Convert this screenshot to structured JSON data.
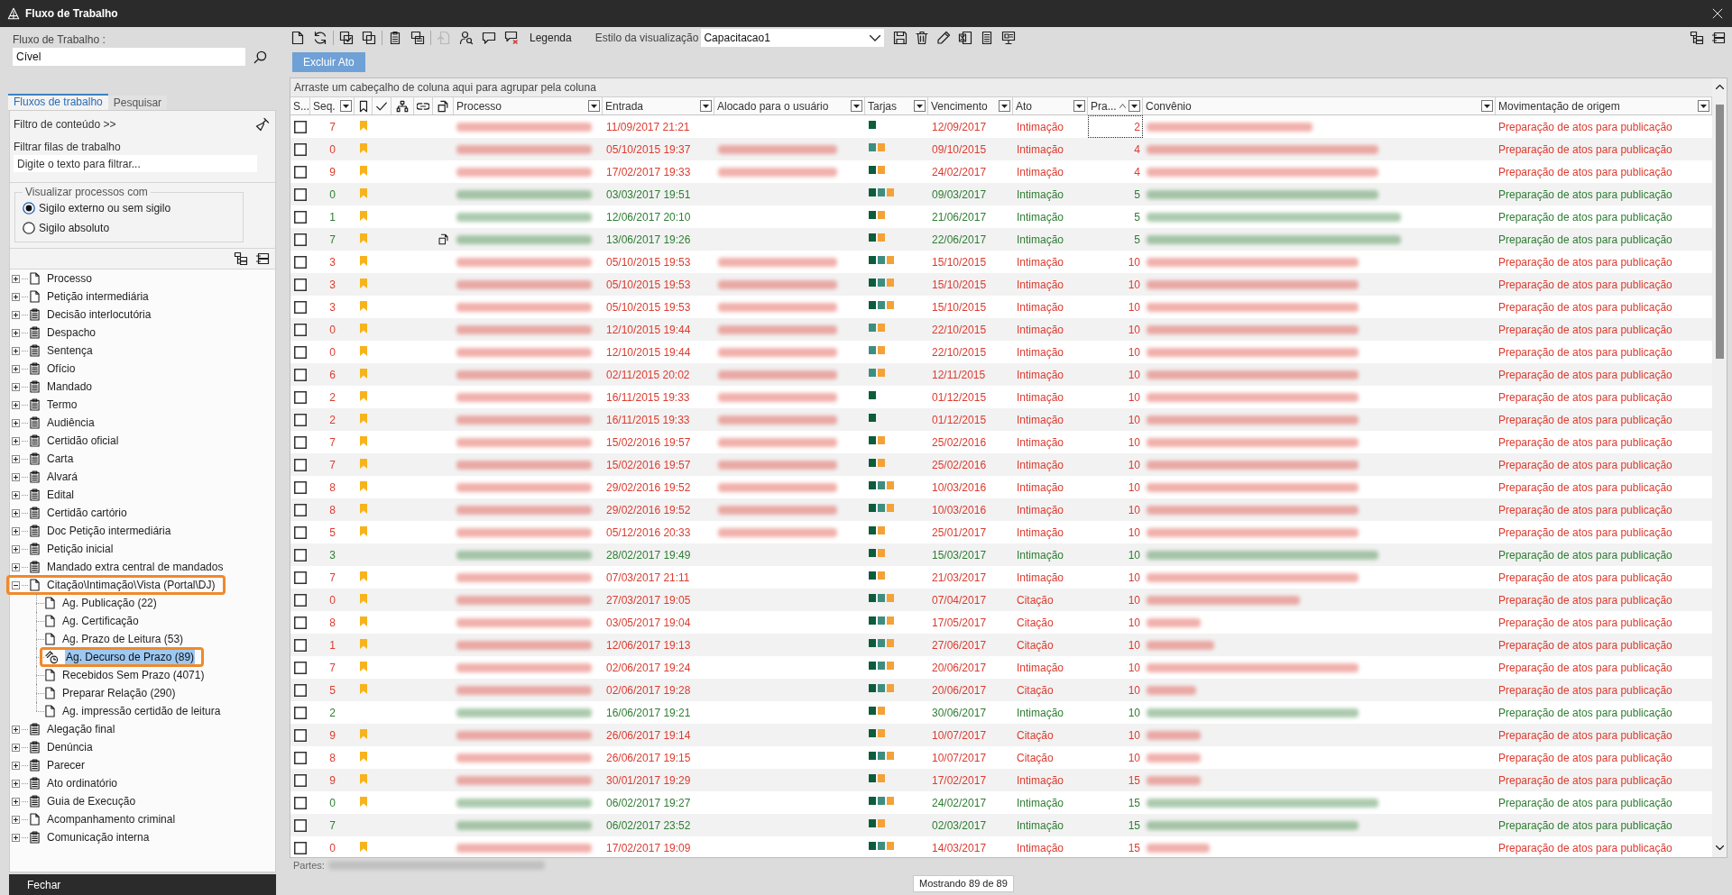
{
  "window": {
    "title": "Fluxo de Trabalho"
  },
  "left_panel": {
    "workflow": {
      "label": "Fluxo de Trabalho :",
      "value": "Cível"
    },
    "tabs": [
      {
        "label": "Fluxos de trabalho",
        "selected": true
      },
      {
        "label": "Pesquisar",
        "selected": false
      }
    ],
    "content_filter": "Filtro de conteúdo >>",
    "queue_filter": {
      "label": "Filtrar filas de trabalho",
      "placeholder": "Digite o texto para filtrar..."
    },
    "visibility": {
      "legend": "Visualizar processos com",
      "options": [
        {
          "label": "Sigilo externo ou sem sigilo",
          "selected": true
        },
        {
          "label": "Sigilo absoluto",
          "selected": false
        }
      ]
    },
    "tree": [
      {
        "label": "Processo",
        "kind": "document",
        "expanded": false,
        "selected": false,
        "highlighted": false
      },
      {
        "label": "Petição intermediária",
        "kind": "document",
        "expanded": false,
        "selected": false,
        "highlighted": false
      },
      {
        "label": "Decisão interlocutória",
        "kind": "clipboard",
        "expanded": false,
        "selected": false,
        "highlighted": false
      },
      {
        "label": "Despacho",
        "kind": "clipboard",
        "expanded": false,
        "selected": false,
        "highlighted": false
      },
      {
        "label": "Sentença",
        "kind": "clipboard",
        "expanded": false,
        "selected": false,
        "highlighted": false
      },
      {
        "label": "Ofício",
        "kind": "clipboard",
        "expanded": false,
        "selected": false,
        "highlighted": false
      },
      {
        "label": "Mandado",
        "kind": "clipboard",
        "expanded": false,
        "selected": false,
        "highlighted": false
      },
      {
        "label": "Termo",
        "kind": "clipboard",
        "expanded": false,
        "selected": false,
        "highlighted": false
      },
      {
        "label": "Audiência",
        "kind": "clipboard",
        "expanded": false,
        "selected": false,
        "highlighted": false
      },
      {
        "label": "Certidão oficial",
        "kind": "clipboard",
        "expanded": false,
        "selected": false,
        "highlighted": false
      },
      {
        "label": "Carta",
        "kind": "clipboard",
        "expanded": false,
        "selected": false,
        "highlighted": false
      },
      {
        "label": "Alvará",
        "kind": "clipboard",
        "expanded": false,
        "selected": false,
        "highlighted": false
      },
      {
        "label": "Edital",
        "kind": "clipboard",
        "expanded": false,
        "selected": false,
        "highlighted": false
      },
      {
        "label": "Certidão cartório",
        "kind": "clipboard",
        "expanded": false,
        "selected": false,
        "highlighted": false
      },
      {
        "label": "Doc Petição intermediária",
        "kind": "clipboard",
        "expanded": false,
        "selected": false,
        "highlighted": false
      },
      {
        "label": "Petição inicial",
        "kind": "clipboard",
        "expanded": false,
        "selected": false,
        "highlighted": false
      },
      {
        "label": "Mandado extra central de mandados",
        "kind": "clipboard",
        "expanded": false,
        "selected": false,
        "highlighted": false
      },
      {
        "label": "Citação\\Intimação\\Vista (Portal\\DJ)",
        "kind": "document",
        "expanded": true,
        "selected": false,
        "highlighted": true,
        "children": [
          {
            "label": "Ag. Publicação (22)",
            "kind": "document",
            "selected": false,
            "highlighted": false
          },
          {
            "label": "Ag. Certificação",
            "kind": "document",
            "selected": false,
            "highlighted": false
          },
          {
            "label": "Ag. Prazo de Leitura (53)",
            "kind": "document",
            "selected": false,
            "highlighted": false
          },
          {
            "label": "Ag. Decurso de Prazo (89)",
            "kind": "clock",
            "selected": true,
            "highlighted": true
          },
          {
            "label": "Recebidos Sem Prazo (4071)",
            "kind": "document",
            "selected": false,
            "highlighted": false
          },
          {
            "label": "Preparar Relação (290)",
            "kind": "document",
            "selected": false,
            "highlighted": false
          },
          {
            "label": "Ag. impressão certidão de leitura",
            "kind": "document",
            "selected": false,
            "highlighted": false
          }
        ]
      },
      {
        "label": "Alegação final",
        "kind": "clipboard",
        "expanded": false,
        "selected": false,
        "highlighted": false
      },
      {
        "label": "Denúncia",
        "kind": "clipboard",
        "expanded": false,
        "selected": false,
        "highlighted": false
      },
      {
        "label": "Parecer",
        "kind": "clipboard",
        "expanded": false,
        "selected": false,
        "highlighted": false
      },
      {
        "label": "Ato ordinatório",
        "kind": "clipboard",
        "expanded": false,
        "selected": false,
        "highlighted": false
      },
      {
        "label": "Guia de Execução",
        "kind": "clipboard",
        "expanded": false,
        "selected": false,
        "highlighted": false
      },
      {
        "label": "Acompanhamento criminal",
        "kind": "document",
        "expanded": false,
        "selected": false,
        "highlighted": false
      },
      {
        "label": "Comunicação interna",
        "kind": "clipboard",
        "expanded": false,
        "selected": false,
        "highlighted": false
      }
    ],
    "close_button": "Fechar"
  },
  "toolbar": {
    "groups": [
      [
        {
          "disabled": false
        },
        {
          "disabled": false
        }
      ],
      [
        {
          "disabled": false
        },
        {
          "disabled": false
        }
      ],
      [
        {
          "disabled": false
        },
        {
          "disabled": false
        }
      ],
      [
        {
          "disabled": true
        },
        {
          "disabled": false
        },
        {
          "disabled": false
        },
        {
          "disabled": false
        }
      ]
    ],
    "legend_button": "Legenda",
    "view_style": {
      "label": "Estilo da visualização",
      "value": "Capacitacao1"
    },
    "style_actions": [
      {
        "disabled": false
      },
      {
        "disabled": false
      },
      {
        "disabled": false
      },
      {
        "disabled": false
      },
      {
        "disabled": false
      },
      {
        "disabled": false
      }
    ]
  },
  "delete_button": "Excluir Ato",
  "grid": {
    "group_hint": "Arraste um cabeçalho de coluna aqui para agrupar pela coluna",
    "columns": [
      {
        "kind": "text",
        "label": "S...",
        "filter": false,
        "sorted": false
      },
      {
        "kind": "text",
        "label": "Seq.",
        "filter": true,
        "sorted": false
      },
      {
        "kind": "icon",
        "filter": false,
        "sorted": false
      },
      {
        "kind": "icon",
        "filter": false,
        "sorted": false
      },
      {
        "kind": "icon",
        "filter": false,
        "sorted": false
      },
      {
        "kind": "icon",
        "filter": false,
        "sorted": false
      },
      {
        "kind": "icon",
        "filter": false,
        "sorted": false
      },
      {
        "kind": "text",
        "label": "Processo",
        "filter": true,
        "sorted": false
      },
      {
        "kind": "text",
        "label": "Entrada",
        "filter": true,
        "sorted": false
      },
      {
        "kind": "text",
        "label": "Alocado para o usuário",
        "filter": true,
        "sorted": false
      },
      {
        "kind": "text",
        "label": "Tarjas",
        "filter": true,
        "sorted": false
      },
      {
        "kind": "text",
        "label": "Vencimento",
        "filter": true,
        "sorted": false
      },
      {
        "kind": "text",
        "label": "Ato",
        "filter": true,
        "sorted": false
      },
      {
        "kind": "text",
        "label": "Pra...",
        "filter": true,
        "sorted": true
      },
      {
        "kind": "text",
        "label": "Convênio",
        "filter": true,
        "sorted": false
      },
      {
        "kind": "text",
        "label": "Movimentação de origem",
        "filter": true,
        "sorted": false
      }
    ],
    "rows": [
      {
        "checked": false,
        "seq": "7",
        "color": "#dc3b2f",
        "bookmarked": true,
        "document_mark": false,
        "entrada": "11/09/2017 21:21",
        "alocado_redacted": false,
        "tarjas": [
          {
            "color": "#0d5c3b"
          }
        ],
        "vencimento": "12/09/2017",
        "ato": "Intimação",
        "prazo": "2",
        "focused": true,
        "movimentacao": "Preparação de atos para publicação"
      },
      {
        "checked": false,
        "seq": "0",
        "color": "#dc3b2f",
        "bookmarked": true,
        "document_mark": false,
        "entrada": "05/10/2015 19:37",
        "alocado_redacted": true,
        "tarjas": [
          {
            "color": "#3d8e80"
          },
          {
            "color": "#f4a137"
          }
        ],
        "vencimento": "09/10/2015",
        "ato": "Intimação",
        "prazo": "4",
        "focused": false,
        "movimentacao": "Preparação de atos para publicação"
      },
      {
        "checked": false,
        "seq": "9",
        "color": "#dc3b2f",
        "bookmarked": true,
        "document_mark": false,
        "entrada": "17/02/2017 19:33",
        "alocado_redacted": true,
        "tarjas": [
          {
            "color": "#0d5c3b"
          },
          {
            "color": "#f4a137"
          }
        ],
        "vencimento": "24/02/2017",
        "ato": "Intimação",
        "prazo": "4",
        "focused": false,
        "movimentacao": "Preparação de atos para publicação"
      },
      {
        "checked": false,
        "seq": "0",
        "color": "#2e7d32",
        "bookmarked": true,
        "document_mark": false,
        "entrada": "03/03/2017 19:51",
        "alocado_redacted": false,
        "tarjas": [
          {
            "color": "#0d5c3b"
          },
          {
            "color": "#3d8e80"
          },
          {
            "color": "#f4a137"
          }
        ],
        "vencimento": "09/03/2017",
        "ato": "Intimação",
        "prazo": "5",
        "focused": false,
        "movimentacao": "Preparação de atos para publicação"
      },
      {
        "checked": false,
        "seq": "1",
        "color": "#2e7d32",
        "bookmarked": true,
        "document_mark": false,
        "entrada": "12/06/2017 20:10",
        "alocado_redacted": false,
        "tarjas": [
          {
            "color": "#0d5c3b"
          },
          {
            "color": "#f4a137"
          }
        ],
        "vencimento": "21/06/2017",
        "ato": "Intimação",
        "prazo": "5",
        "focused": false,
        "movimentacao": "Preparação de atos para publicação"
      },
      {
        "checked": false,
        "seq": "7",
        "color": "#2e7d32",
        "bookmarked": true,
        "document_mark": true,
        "entrada": "13/06/2017 19:26",
        "alocado_redacted": false,
        "tarjas": [
          {
            "color": "#0d5c3b"
          },
          {
            "color": "#f4a137"
          }
        ],
        "vencimento": "22/06/2017",
        "ato": "Intimação",
        "prazo": "5",
        "focused": false,
        "movimentacao": "Preparação de atos para publicação"
      },
      {
        "checked": false,
        "seq": "3",
        "color": "#dc3b2f",
        "bookmarked": true,
        "document_mark": false,
        "entrada": "05/10/2015 19:53",
        "alocado_redacted": true,
        "tarjas": [
          {
            "color": "#0d5c3b"
          },
          {
            "color": "#3d8e80"
          },
          {
            "color": "#f4a137"
          }
        ],
        "vencimento": "15/10/2015",
        "ato": "Intimação",
        "prazo": "10",
        "focused": false,
        "movimentacao": "Preparação de atos para publicação"
      },
      {
        "checked": false,
        "seq": "3",
        "color": "#dc3b2f",
        "bookmarked": true,
        "document_mark": false,
        "entrada": "05/10/2015 19:53",
        "alocado_redacted": true,
        "tarjas": [
          {
            "color": "#0d5c3b"
          },
          {
            "color": "#3d8e80"
          },
          {
            "color": "#f4a137"
          }
        ],
        "vencimento": "15/10/2015",
        "ato": "Intimação",
        "prazo": "10",
        "focused": false,
        "movimentacao": "Preparação de atos para publicação"
      },
      {
        "checked": false,
        "seq": "3",
        "color": "#dc3b2f",
        "bookmarked": true,
        "document_mark": false,
        "entrada": "05/10/2015 19:53",
        "alocado_redacted": true,
        "tarjas": [
          {
            "color": "#0d5c3b"
          },
          {
            "color": "#3d8e80"
          },
          {
            "color": "#f4a137"
          }
        ],
        "vencimento": "15/10/2015",
        "ato": "Intimação",
        "prazo": "10",
        "focused": false,
        "movimentacao": "Preparação de atos para publicação"
      },
      {
        "checked": false,
        "seq": "0",
        "color": "#dc3b2f",
        "bookmarked": true,
        "document_mark": false,
        "entrada": "12/10/2015 19:44",
        "alocado_redacted": true,
        "tarjas": [
          {
            "color": "#3d8e80"
          },
          {
            "color": "#f4a137"
          }
        ],
        "vencimento": "22/10/2015",
        "ato": "Intimação",
        "prazo": "10",
        "focused": false,
        "movimentacao": "Preparação de atos para publicação"
      },
      {
        "checked": false,
        "seq": "0",
        "color": "#dc3b2f",
        "bookmarked": true,
        "document_mark": false,
        "entrada": "12/10/2015 19:44",
        "alocado_redacted": true,
        "tarjas": [
          {
            "color": "#3d8e80"
          },
          {
            "color": "#f4a137"
          }
        ],
        "vencimento": "22/10/2015",
        "ato": "Intimação",
        "prazo": "10",
        "focused": false,
        "movimentacao": "Preparação de atos para publicação"
      },
      {
        "checked": false,
        "seq": "6",
        "color": "#dc3b2f",
        "bookmarked": true,
        "document_mark": false,
        "entrada": "02/11/2015 20:02",
        "alocado_redacted": true,
        "tarjas": [
          {
            "color": "#3d8e80"
          },
          {
            "color": "#f4a137"
          }
        ],
        "vencimento": "12/11/2015",
        "ato": "Intimação",
        "prazo": "10",
        "focused": false,
        "movimentacao": "Preparação de atos para publicação"
      },
      {
        "checked": false,
        "seq": "2",
        "color": "#dc3b2f",
        "bookmarked": true,
        "document_mark": false,
        "entrada": "16/11/2015 19:33",
        "alocado_redacted": true,
        "tarjas": [
          {
            "color": "#0d5c3b"
          }
        ],
        "vencimento": "01/12/2015",
        "ato": "Intimação",
        "prazo": "10",
        "focused": false,
        "movimentacao": "Preparação de atos para publicação"
      },
      {
        "checked": false,
        "seq": "2",
        "color": "#dc3b2f",
        "bookmarked": true,
        "document_mark": false,
        "entrada": "16/11/2015 19:33",
        "alocado_redacted": true,
        "tarjas": [
          {
            "color": "#0d5c3b"
          }
        ],
        "vencimento": "01/12/2015",
        "ato": "Intimação",
        "prazo": "10",
        "focused": false,
        "movimentacao": "Preparação de atos para publicação"
      },
      {
        "checked": false,
        "seq": "7",
        "color": "#dc3b2f",
        "bookmarked": true,
        "document_mark": false,
        "entrada": "15/02/2016 19:57",
        "alocado_redacted": true,
        "tarjas": [
          {
            "color": "#0d5c3b"
          },
          {
            "color": "#f4a137"
          }
        ],
        "vencimento": "25/02/2016",
        "ato": "Intimação",
        "prazo": "10",
        "focused": false,
        "movimentacao": "Preparação de atos para publicação"
      },
      {
        "checked": false,
        "seq": "7",
        "color": "#dc3b2f",
        "bookmarked": true,
        "document_mark": false,
        "entrada": "15/02/2016 19:57",
        "alocado_redacted": true,
        "tarjas": [
          {
            "color": "#0d5c3b"
          },
          {
            "color": "#f4a137"
          }
        ],
        "vencimento": "25/02/2016",
        "ato": "Intimação",
        "prazo": "10",
        "focused": false,
        "movimentacao": "Preparação de atos para publicação"
      },
      {
        "checked": false,
        "seq": "8",
        "color": "#dc3b2f",
        "bookmarked": true,
        "document_mark": false,
        "entrada": "29/02/2016 19:52",
        "alocado_redacted": true,
        "tarjas": [
          {
            "color": "#0d5c3b"
          },
          {
            "color": "#3d8e80"
          },
          {
            "color": "#f4a137"
          }
        ],
        "vencimento": "10/03/2016",
        "ato": "Intimação",
        "prazo": "10",
        "focused": false,
        "movimentacao": "Preparação de atos para publicação"
      },
      {
        "checked": false,
        "seq": "8",
        "color": "#dc3b2f",
        "bookmarked": true,
        "document_mark": false,
        "entrada": "29/02/2016 19:52",
        "alocado_redacted": true,
        "tarjas": [
          {
            "color": "#0d5c3b"
          },
          {
            "color": "#3d8e80"
          },
          {
            "color": "#f4a137"
          }
        ],
        "vencimento": "10/03/2016",
        "ato": "Intimação",
        "prazo": "10",
        "focused": false,
        "movimentacao": "Preparação de atos para publicação"
      },
      {
        "checked": false,
        "seq": "5",
        "color": "#dc3b2f",
        "bookmarked": true,
        "document_mark": false,
        "entrada": "05/12/2016 20:33",
        "alocado_redacted": true,
        "tarjas": [
          {
            "color": "#0d5c3b"
          },
          {
            "color": "#f4a137"
          }
        ],
        "vencimento": "25/01/2017",
        "ato": "Intimação",
        "prazo": "10",
        "focused": false,
        "movimentacao": "Preparação de atos para publicação"
      },
      {
        "checked": false,
        "seq": "3",
        "color": "#2e7d32",
        "bookmarked": false,
        "document_mark": false,
        "entrada": "28/02/2017 19:49",
        "alocado_redacted": false,
        "tarjas": [
          {
            "color": "#0d5c3b"
          },
          {
            "color": "#f4a137"
          }
        ],
        "vencimento": "15/03/2017",
        "ato": "Intimação",
        "prazo": "10",
        "focused": false,
        "movimentacao": "Preparação de atos para publicação"
      },
      {
        "checked": false,
        "seq": "7",
        "color": "#dc3b2f",
        "bookmarked": true,
        "document_mark": false,
        "entrada": "07/03/2017 21:11",
        "alocado_redacted": false,
        "tarjas": [
          {
            "color": "#0d5c3b"
          },
          {
            "color": "#f4a137"
          }
        ],
        "vencimento": "21/03/2017",
        "ato": "Intimação",
        "prazo": "10",
        "focused": false,
        "movimentacao": "Preparação de atos para publicação"
      },
      {
        "checked": false,
        "seq": "0",
        "color": "#dc3b2f",
        "bookmarked": true,
        "document_mark": false,
        "entrada": "27/03/2017 19:05",
        "alocado_redacted": false,
        "tarjas": [
          {
            "color": "#0d5c3b"
          },
          {
            "color": "#3d8e80"
          },
          {
            "color": "#f4a137"
          }
        ],
        "vencimento": "07/04/2017",
        "ato": "Citação",
        "prazo": "10",
        "focused": false,
        "movimentacao": "Preparação de atos para publicação"
      },
      {
        "checked": false,
        "seq": "8",
        "color": "#dc3b2f",
        "bookmarked": true,
        "document_mark": false,
        "entrada": "03/05/2017 19:04",
        "alocado_redacted": false,
        "tarjas": [
          {
            "color": "#0d5c3b"
          },
          {
            "color": "#3d8e80"
          },
          {
            "color": "#f4a137"
          }
        ],
        "vencimento": "17/05/2017",
        "ato": "Citação",
        "prazo": "10",
        "focused": false,
        "movimentacao": "Preparação de atos para publicação"
      },
      {
        "checked": false,
        "seq": "1",
        "color": "#dc3b2f",
        "bookmarked": true,
        "document_mark": false,
        "entrada": "12/06/2017 19:13",
        "alocado_redacted": false,
        "tarjas": [
          {
            "color": "#0d5c3b"
          },
          {
            "color": "#3d8e80"
          },
          {
            "color": "#f4a137"
          }
        ],
        "vencimento": "27/06/2017",
        "ato": "Citação",
        "prazo": "10",
        "focused": false,
        "movimentacao": "Preparação de atos para publicação"
      },
      {
        "checked": false,
        "seq": "7",
        "color": "#dc3b2f",
        "bookmarked": true,
        "document_mark": false,
        "entrada": "02/06/2017 19:24",
        "alocado_redacted": false,
        "tarjas": [
          {
            "color": "#0d5c3b"
          },
          {
            "color": "#3d8e80"
          },
          {
            "color": "#f4a137"
          }
        ],
        "vencimento": "20/06/2017",
        "ato": "Intimação",
        "prazo": "10",
        "focused": false,
        "movimentacao": "Preparação de atos para publicação"
      },
      {
        "checked": false,
        "seq": "5",
        "color": "#dc3b2f",
        "bookmarked": true,
        "document_mark": false,
        "entrada": "02/06/2017 19:28",
        "alocado_redacted": false,
        "tarjas": [
          {
            "color": "#0d5c3b"
          },
          {
            "color": "#3d8e80"
          },
          {
            "color": "#f4a137"
          }
        ],
        "vencimento": "20/06/2017",
        "ato": "Citação",
        "prazo": "10",
        "focused": false,
        "movimentacao": "Preparação de atos para publicação"
      },
      {
        "checked": false,
        "seq": "2",
        "color": "#2e7d32",
        "bookmarked": false,
        "document_mark": false,
        "entrada": "16/06/2017 19:21",
        "alocado_redacted": false,
        "tarjas": [
          {
            "color": "#0d5c3b"
          },
          {
            "color": "#f4a137"
          }
        ],
        "vencimento": "30/06/2017",
        "ato": "Intimação",
        "prazo": "10",
        "focused": false,
        "movimentacao": "Preparação de atos para publicação"
      },
      {
        "checked": false,
        "seq": "9",
        "color": "#dc3b2f",
        "bookmarked": true,
        "document_mark": false,
        "entrada": "26/06/2017 19:14",
        "alocado_redacted": false,
        "tarjas": [
          {
            "color": "#0d5c3b"
          },
          {
            "color": "#f4a137"
          }
        ],
        "vencimento": "10/07/2017",
        "ato": "Citação",
        "prazo": "10",
        "focused": false,
        "movimentacao": "Preparação de atos para publicação"
      },
      {
        "checked": false,
        "seq": "8",
        "color": "#dc3b2f",
        "bookmarked": true,
        "document_mark": false,
        "entrada": "26/06/2017 19:15",
        "alocado_redacted": false,
        "tarjas": [
          {
            "color": "#0d5c3b"
          },
          {
            "color": "#3d8e80"
          },
          {
            "color": "#f4a137"
          }
        ],
        "vencimento": "10/07/2017",
        "ato": "Citação",
        "prazo": "10",
        "focused": false,
        "movimentacao": "Preparação de atos para publicação"
      },
      {
        "checked": false,
        "seq": "9",
        "color": "#dc3b2f",
        "bookmarked": true,
        "document_mark": false,
        "entrada": "30/01/2017 19:29",
        "alocado_redacted": false,
        "tarjas": [
          {
            "color": "#0d5c3b"
          },
          {
            "color": "#f4a137"
          }
        ],
        "vencimento": "17/02/2017",
        "ato": "Intimação",
        "prazo": "15",
        "focused": false,
        "movimentacao": "Preparação de atos para publicação"
      },
      {
        "checked": false,
        "seq": "0",
        "color": "#2e7d32",
        "bookmarked": true,
        "document_mark": false,
        "entrada": "06/02/2017 19:27",
        "alocado_redacted": false,
        "tarjas": [
          {
            "color": "#0d5c3b"
          },
          {
            "color": "#3d8e80"
          },
          {
            "color": "#f4a137"
          }
        ],
        "vencimento": "24/02/2017",
        "ato": "Intimação",
        "prazo": "15",
        "focused": false,
        "movimentacao": "Preparação de atos para publicação"
      },
      {
        "checked": false,
        "seq": "7",
        "color": "#2e7d32",
        "bookmarked": false,
        "document_mark": false,
        "entrada": "06/02/2017 23:52",
        "alocado_redacted": false,
        "tarjas": [
          {
            "color": "#0d5c3b"
          },
          {
            "color": "#f4a137"
          }
        ],
        "vencimento": "02/03/2017",
        "ato": "Intimação",
        "prazo": "15",
        "focused": false,
        "movimentacao": "Preparação de atos para publicação"
      },
      {
        "checked": false,
        "seq": "0",
        "color": "#dc3b2f",
        "bookmarked": true,
        "document_mark": false,
        "entrada": "17/02/2017 19:09",
        "alocado_redacted": false,
        "tarjas": [
          {
            "color": "#0d5c3b"
          },
          {
            "color": "#3d8e80"
          },
          {
            "color": "#f4a137"
          }
        ],
        "vencimento": "14/03/2017",
        "ato": "Intimação",
        "prazo": "15",
        "focused": false,
        "movimentacao": "Preparação de atos para publicação"
      }
    ],
    "parties_label": "Partes:",
    "status": "Mostrando 89 de 89"
  }
}
